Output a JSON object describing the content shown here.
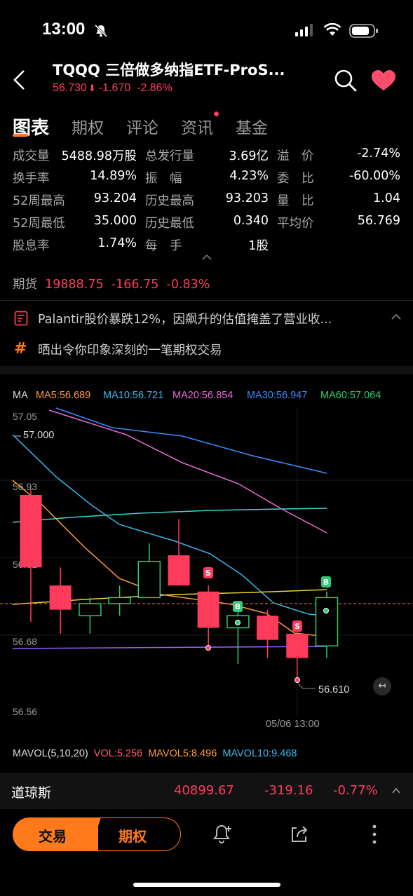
{
  "status": {
    "time": "13:00"
  },
  "header": {
    "title": "TQQQ  三倍做多纳指ETF-ProS...",
    "price": "56.730",
    "change": "-1.670",
    "change_pct": "-2.86%"
  },
  "tabs": [
    "图表",
    "期权",
    "评论",
    "资讯",
    "基金"
  ],
  "stats": [
    [
      "成交量",
      "5488.98万股",
      "总发行量",
      "3.69亿",
      "溢　价",
      "-2.74%"
    ],
    [
      "换手率",
      "14.89%",
      "振　幅",
      "4.23%",
      "委　比",
      "-60.00%"
    ],
    [
      "52周最高",
      "93.204",
      "历史最高",
      "93.203",
      "量　比",
      "1.04"
    ],
    [
      "52周最低",
      "35.000",
      "历史最低",
      "0.340",
      "平均价",
      "56.769"
    ],
    [
      "股息率",
      "1.74%",
      "每　手",
      "1股",
      "",
      ""
    ]
  ],
  "futures": {
    "label": "期货",
    "value": "19888.75",
    "change": "-166.75",
    "pct": "-0.83%"
  },
  "news": {
    "headline": "Palantir股价暴跌12%，因飙升的估值掩盖了营业收...",
    "promo": "晒出令你印象深刻的一笔期权交易"
  },
  "ma": {
    "label": "MA",
    "items": [
      {
        "text": "MA5:56.689",
        "color": "#ff9a3c"
      },
      {
        "text": "MA10:56.721",
        "color": "#3cb6e8"
      },
      {
        "text": "MA20:56.854",
        "color": "#e86ad8"
      },
      {
        "text": "MA30:56.947",
        "color": "#3d8cff"
      },
      {
        "text": "MA60:57.064",
        "color": "#2ecc71"
      }
    ]
  },
  "chart": {
    "y_ticks": [
      "57.05",
      "56.93",
      "56.81",
      "56.68",
      "56.56"
    ],
    "high_label": "57.000",
    "low_label": "56.610",
    "time_label": "05/06 13:00",
    "marker_b": "B",
    "marker_s": "S"
  },
  "chart_data": {
    "type": "candlestick",
    "y_range": [
      56.56,
      57.05
    ],
    "candles": [
      {
        "o": 56.92,
        "h": 56.93,
        "l": 56.71,
        "c": 56.8,
        "dir": "down"
      },
      {
        "o": 56.77,
        "h": 56.8,
        "l": 56.69,
        "c": 56.73,
        "dir": "down"
      },
      {
        "o": 56.72,
        "h": 56.75,
        "l": 56.69,
        "c": 56.74,
        "dir": "up"
      },
      {
        "o": 56.74,
        "h": 56.77,
        "l": 56.72,
        "c": 56.75,
        "dir": "up"
      },
      {
        "o": 56.75,
        "h": 56.84,
        "l": 56.75,
        "c": 56.81,
        "dir": "up"
      },
      {
        "o": 56.82,
        "h": 56.88,
        "l": 56.77,
        "c": 56.77,
        "dir": "down"
      },
      {
        "o": 56.76,
        "h": 56.77,
        "l": 56.67,
        "c": 56.7,
        "dir": "down"
      },
      {
        "o": 56.7,
        "h": 56.73,
        "l": 56.64,
        "c": 56.72,
        "dir": "up"
      },
      {
        "o": 56.72,
        "h": 56.73,
        "l": 56.65,
        "c": 56.68,
        "dir": "down"
      },
      {
        "o": 56.69,
        "h": 56.7,
        "l": 56.61,
        "c": 56.65,
        "dir": "down"
      },
      {
        "o": 56.67,
        "h": 56.76,
        "l": 56.65,
        "c": 56.75,
        "dir": "up"
      }
    ],
    "ref_price": 56.75
  },
  "mavol": {
    "label": "MAVOL(5,10,20)",
    "vol": "VOL:5.256",
    "mavol5": "MAVOL5:8.496",
    "mavol10": "MAVOL10:9.468"
  },
  "ticker": {
    "name": "道琼斯",
    "value": "40899.67",
    "change": "-319.16",
    "pct": "-0.77%"
  },
  "footer": {
    "trade": "交易",
    "options": "期权"
  },
  "colors": {
    "up": "#2ecc71",
    "down": "#ff3b5c",
    "accent": "#ff7a1a"
  }
}
